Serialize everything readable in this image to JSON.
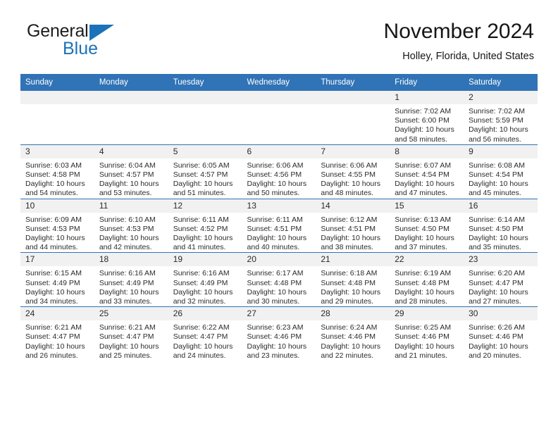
{
  "brand": {
    "name_top": "General",
    "name_bottom": "Blue",
    "triangle_color": "#1b72b8",
    "logo_icon": "general-blue-logo-icon"
  },
  "header": {
    "month_title": "November 2024",
    "location": "Holley, Florida, United States"
  },
  "theme": {
    "header_row_color": "#3073b6",
    "day_number_band_color": "#f1f1f1",
    "grid_line_color": "#3073b6",
    "text_color": "#2b2b2b"
  },
  "weekday_headers": [
    "Sunday",
    "Monday",
    "Tuesday",
    "Wednesday",
    "Thursday",
    "Friday",
    "Saturday"
  ],
  "weeks": [
    [
      {
        "day": "",
        "empty": true,
        "sunrise": "",
        "sunset": "",
        "daylight_line1": "",
        "daylight_line2": ""
      },
      {
        "day": "",
        "empty": true,
        "sunrise": "",
        "sunset": "",
        "daylight_line1": "",
        "daylight_line2": ""
      },
      {
        "day": "",
        "empty": true,
        "sunrise": "",
        "sunset": "",
        "daylight_line1": "",
        "daylight_line2": ""
      },
      {
        "day": "",
        "empty": true,
        "sunrise": "",
        "sunset": "",
        "daylight_line1": "",
        "daylight_line2": ""
      },
      {
        "day": "",
        "empty": true,
        "sunrise": "",
        "sunset": "",
        "daylight_line1": "",
        "daylight_line2": ""
      },
      {
        "day": "1",
        "empty": false,
        "sunrise": "Sunrise: 7:02 AM",
        "sunset": "Sunset: 6:00 PM",
        "daylight_line1": "Daylight: 10 hours",
        "daylight_line2": "and 58 minutes."
      },
      {
        "day": "2",
        "empty": false,
        "sunrise": "Sunrise: 7:02 AM",
        "sunset": "Sunset: 5:59 PM",
        "daylight_line1": "Daylight: 10 hours",
        "daylight_line2": "and 56 minutes."
      }
    ],
    [
      {
        "day": "3",
        "empty": false,
        "sunrise": "Sunrise: 6:03 AM",
        "sunset": "Sunset: 4:58 PM",
        "daylight_line1": "Daylight: 10 hours",
        "daylight_line2": "and 54 minutes."
      },
      {
        "day": "4",
        "empty": false,
        "sunrise": "Sunrise: 6:04 AM",
        "sunset": "Sunset: 4:57 PM",
        "daylight_line1": "Daylight: 10 hours",
        "daylight_line2": "and 53 minutes."
      },
      {
        "day": "5",
        "empty": false,
        "sunrise": "Sunrise: 6:05 AM",
        "sunset": "Sunset: 4:57 PM",
        "daylight_line1": "Daylight: 10 hours",
        "daylight_line2": "and 51 minutes."
      },
      {
        "day": "6",
        "empty": false,
        "sunrise": "Sunrise: 6:06 AM",
        "sunset": "Sunset: 4:56 PM",
        "daylight_line1": "Daylight: 10 hours",
        "daylight_line2": "and 50 minutes."
      },
      {
        "day": "7",
        "empty": false,
        "sunrise": "Sunrise: 6:06 AM",
        "sunset": "Sunset: 4:55 PM",
        "daylight_line1": "Daylight: 10 hours",
        "daylight_line2": "and 48 minutes."
      },
      {
        "day": "8",
        "empty": false,
        "sunrise": "Sunrise: 6:07 AM",
        "sunset": "Sunset: 4:54 PM",
        "daylight_line1": "Daylight: 10 hours",
        "daylight_line2": "and 47 minutes."
      },
      {
        "day": "9",
        "empty": false,
        "sunrise": "Sunrise: 6:08 AM",
        "sunset": "Sunset: 4:54 PM",
        "daylight_line1": "Daylight: 10 hours",
        "daylight_line2": "and 45 minutes."
      }
    ],
    [
      {
        "day": "10",
        "empty": false,
        "sunrise": "Sunrise: 6:09 AM",
        "sunset": "Sunset: 4:53 PM",
        "daylight_line1": "Daylight: 10 hours",
        "daylight_line2": "and 44 minutes."
      },
      {
        "day": "11",
        "empty": false,
        "sunrise": "Sunrise: 6:10 AM",
        "sunset": "Sunset: 4:53 PM",
        "daylight_line1": "Daylight: 10 hours",
        "daylight_line2": "and 42 minutes."
      },
      {
        "day": "12",
        "empty": false,
        "sunrise": "Sunrise: 6:11 AM",
        "sunset": "Sunset: 4:52 PM",
        "daylight_line1": "Daylight: 10 hours",
        "daylight_line2": "and 41 minutes."
      },
      {
        "day": "13",
        "empty": false,
        "sunrise": "Sunrise: 6:11 AM",
        "sunset": "Sunset: 4:51 PM",
        "daylight_line1": "Daylight: 10 hours",
        "daylight_line2": "and 40 minutes."
      },
      {
        "day": "14",
        "empty": false,
        "sunrise": "Sunrise: 6:12 AM",
        "sunset": "Sunset: 4:51 PM",
        "daylight_line1": "Daylight: 10 hours",
        "daylight_line2": "and 38 minutes."
      },
      {
        "day": "15",
        "empty": false,
        "sunrise": "Sunrise: 6:13 AM",
        "sunset": "Sunset: 4:50 PM",
        "daylight_line1": "Daylight: 10 hours",
        "daylight_line2": "and 37 minutes."
      },
      {
        "day": "16",
        "empty": false,
        "sunrise": "Sunrise: 6:14 AM",
        "sunset": "Sunset: 4:50 PM",
        "daylight_line1": "Daylight: 10 hours",
        "daylight_line2": "and 35 minutes."
      }
    ],
    [
      {
        "day": "17",
        "empty": false,
        "sunrise": "Sunrise: 6:15 AM",
        "sunset": "Sunset: 4:49 PM",
        "daylight_line1": "Daylight: 10 hours",
        "daylight_line2": "and 34 minutes."
      },
      {
        "day": "18",
        "empty": false,
        "sunrise": "Sunrise: 6:16 AM",
        "sunset": "Sunset: 4:49 PM",
        "daylight_line1": "Daylight: 10 hours",
        "daylight_line2": "and 33 minutes."
      },
      {
        "day": "19",
        "empty": false,
        "sunrise": "Sunrise: 6:16 AM",
        "sunset": "Sunset: 4:49 PM",
        "daylight_line1": "Daylight: 10 hours",
        "daylight_line2": "and 32 minutes."
      },
      {
        "day": "20",
        "empty": false,
        "sunrise": "Sunrise: 6:17 AM",
        "sunset": "Sunset: 4:48 PM",
        "daylight_line1": "Daylight: 10 hours",
        "daylight_line2": "and 30 minutes."
      },
      {
        "day": "21",
        "empty": false,
        "sunrise": "Sunrise: 6:18 AM",
        "sunset": "Sunset: 4:48 PM",
        "daylight_line1": "Daylight: 10 hours",
        "daylight_line2": "and 29 minutes."
      },
      {
        "day": "22",
        "empty": false,
        "sunrise": "Sunrise: 6:19 AM",
        "sunset": "Sunset: 4:48 PM",
        "daylight_line1": "Daylight: 10 hours",
        "daylight_line2": "and 28 minutes."
      },
      {
        "day": "23",
        "empty": false,
        "sunrise": "Sunrise: 6:20 AM",
        "sunset": "Sunset: 4:47 PM",
        "daylight_line1": "Daylight: 10 hours",
        "daylight_line2": "and 27 minutes."
      }
    ],
    [
      {
        "day": "24",
        "empty": false,
        "sunrise": "Sunrise: 6:21 AM",
        "sunset": "Sunset: 4:47 PM",
        "daylight_line1": "Daylight: 10 hours",
        "daylight_line2": "and 26 minutes."
      },
      {
        "day": "25",
        "empty": false,
        "sunrise": "Sunrise: 6:21 AM",
        "sunset": "Sunset: 4:47 PM",
        "daylight_line1": "Daylight: 10 hours",
        "daylight_line2": "and 25 minutes."
      },
      {
        "day": "26",
        "empty": false,
        "sunrise": "Sunrise: 6:22 AM",
        "sunset": "Sunset: 4:47 PM",
        "daylight_line1": "Daylight: 10 hours",
        "daylight_line2": "and 24 minutes."
      },
      {
        "day": "27",
        "empty": false,
        "sunrise": "Sunrise: 6:23 AM",
        "sunset": "Sunset: 4:46 PM",
        "daylight_line1": "Daylight: 10 hours",
        "daylight_line2": "and 23 minutes."
      },
      {
        "day": "28",
        "empty": false,
        "sunrise": "Sunrise: 6:24 AM",
        "sunset": "Sunset: 4:46 PM",
        "daylight_line1": "Daylight: 10 hours",
        "daylight_line2": "and 22 minutes."
      },
      {
        "day": "29",
        "empty": false,
        "sunrise": "Sunrise: 6:25 AM",
        "sunset": "Sunset: 4:46 PM",
        "daylight_line1": "Daylight: 10 hours",
        "daylight_line2": "and 21 minutes."
      },
      {
        "day": "30",
        "empty": false,
        "sunrise": "Sunrise: 6:26 AM",
        "sunset": "Sunset: 4:46 PM",
        "daylight_line1": "Daylight: 10 hours",
        "daylight_line2": "and 20 minutes."
      }
    ]
  ]
}
